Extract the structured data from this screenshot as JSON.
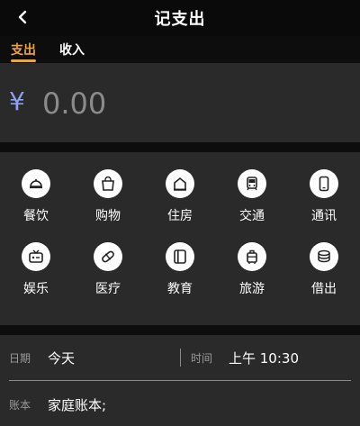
{
  "header": {
    "title": "记支出",
    "back_icon": "back-arrow-icon"
  },
  "tabs": [
    {
      "label": "支出",
      "active": true
    },
    {
      "label": "收入",
      "active": false
    }
  ],
  "calculator_icon": "calculator-icon",
  "amount": {
    "currency": "¥",
    "value": "0.00"
  },
  "categories": [
    {
      "label": "餐饮",
      "icon": "dish-cloche-icon"
    },
    {
      "label": "购物",
      "icon": "shopping-bag-icon"
    },
    {
      "label": "住房",
      "icon": "house-icon"
    },
    {
      "label": "交通",
      "icon": "bus-icon"
    },
    {
      "label": "通讯",
      "icon": "phone-icon"
    },
    {
      "label": "娱乐",
      "icon": "tv-icon"
    },
    {
      "label": "医疗",
      "icon": "pill-icon"
    },
    {
      "label": "教育",
      "icon": "book-icon"
    },
    {
      "label": "旅游",
      "icon": "luggage-icon"
    },
    {
      "label": "借出",
      "icon": "coins-icon"
    }
  ],
  "form": {
    "date_label": "日期",
    "date_value": "今天",
    "time_label": "时间",
    "time_value": "上午 10:30",
    "account_label": "账本",
    "account_value": "家庭账本;"
  },
  "colors": {
    "accent": "#f0a33a",
    "currency": "#8ea0ee",
    "panel": "#2a2a2a",
    "background": "#0d0d0d"
  }
}
